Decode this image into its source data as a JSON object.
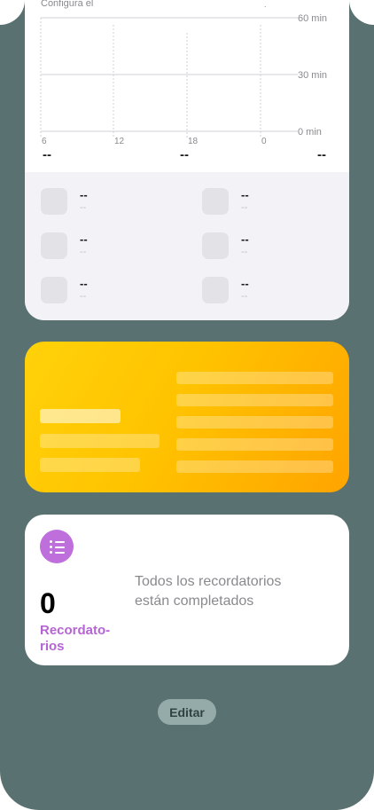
{
  "screen_time": {
    "header": "Configura el",
    "header_dot": ".",
    "chart_data": {
      "type": "bar",
      "x_tick_labels": [
        "6",
        "12",
        "18",
        "0"
      ],
      "y_tick_labels": [
        "60 min",
        "30 min",
        "0 min"
      ],
      "ylim": [
        0,
        60
      ],
      "values": []
    },
    "totals": [
      "--",
      "--",
      "--"
    ],
    "apps": [
      {
        "name": "--",
        "time": "--"
      },
      {
        "name": "--",
        "time": "--"
      },
      {
        "name": "--",
        "time": "--"
      },
      {
        "name": "--",
        "time": "--"
      },
      {
        "name": "--",
        "time": "--"
      },
      {
        "name": "--",
        "time": "--"
      }
    ]
  },
  "reminders": {
    "icon": "list-icon",
    "accent": "#bf6fdc",
    "count": "0",
    "label": "Recordato-rios",
    "message": "Todos los recordatorios están completados"
  },
  "edit_label": "Editar"
}
